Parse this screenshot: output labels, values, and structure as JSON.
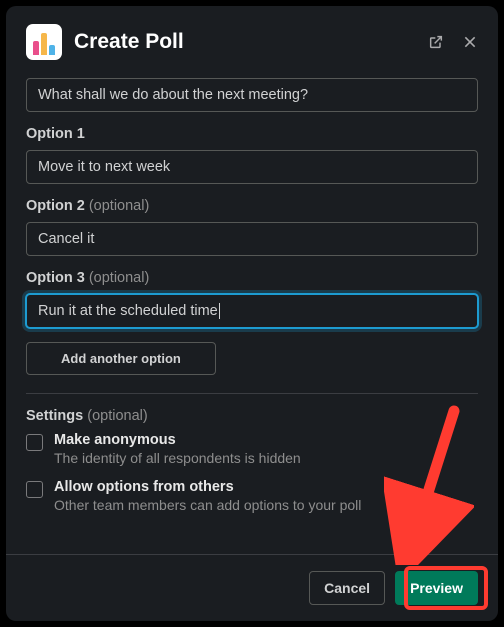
{
  "header": {
    "title": "Create Poll"
  },
  "question": {
    "value": "What shall we do about the next meeting?"
  },
  "options": [
    {
      "label": "Option 1",
      "optional": "",
      "value": "Move it to next week",
      "focused": false
    },
    {
      "label": "Option 2",
      "optional": "(optional)",
      "value": "Cancel it",
      "focused": false
    },
    {
      "label": "Option 3",
      "optional": "(optional)",
      "value": "Run it at the scheduled time",
      "focused": true
    }
  ],
  "add_option_label": "Add another option",
  "settings": {
    "label": "Settings",
    "optional": "(optional)",
    "items": [
      {
        "title": "Make anonymous",
        "desc": "The identity of all respondents is hidden",
        "checked": false
      },
      {
        "title": "Allow options from others",
        "desc": "Other team members can add options to your poll",
        "checked": false
      }
    ]
  },
  "footer": {
    "cancel": "Cancel",
    "preview": "Preview"
  },
  "colors": {
    "accent": "#007a5a",
    "focus": "#1d9bd1",
    "annotation": "#ff3b30"
  }
}
